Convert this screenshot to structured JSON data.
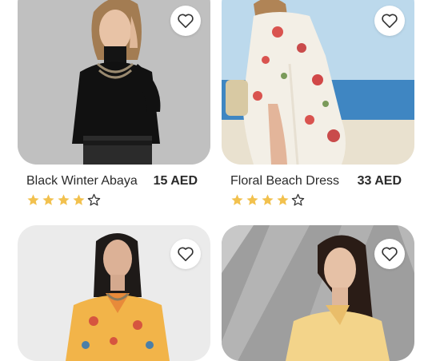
{
  "products": [
    {
      "name": "Black Winter Abaya",
      "price": "15 AED",
      "rating": 4,
      "rating_max": 5,
      "image": "woman-black-turtleneck",
      "favorite_icon": "heart-outline-icon"
    },
    {
      "name": "Floral Beach Dress",
      "price": "33 AED",
      "rating": 4,
      "rating_max": 5,
      "image": "woman-floral-dress-beach",
      "favorite_icon": "heart-outline-icon"
    },
    {
      "image": "woman-floral-kurta",
      "favorite_icon": "heart-outline-icon"
    },
    {
      "image": "woman-yellow-top",
      "favorite_icon": "heart-outline-icon"
    }
  ],
  "colors": {
    "star_filled": "#F2C14E",
    "star_outline": "#333333",
    "text": "#2A2A2A"
  }
}
